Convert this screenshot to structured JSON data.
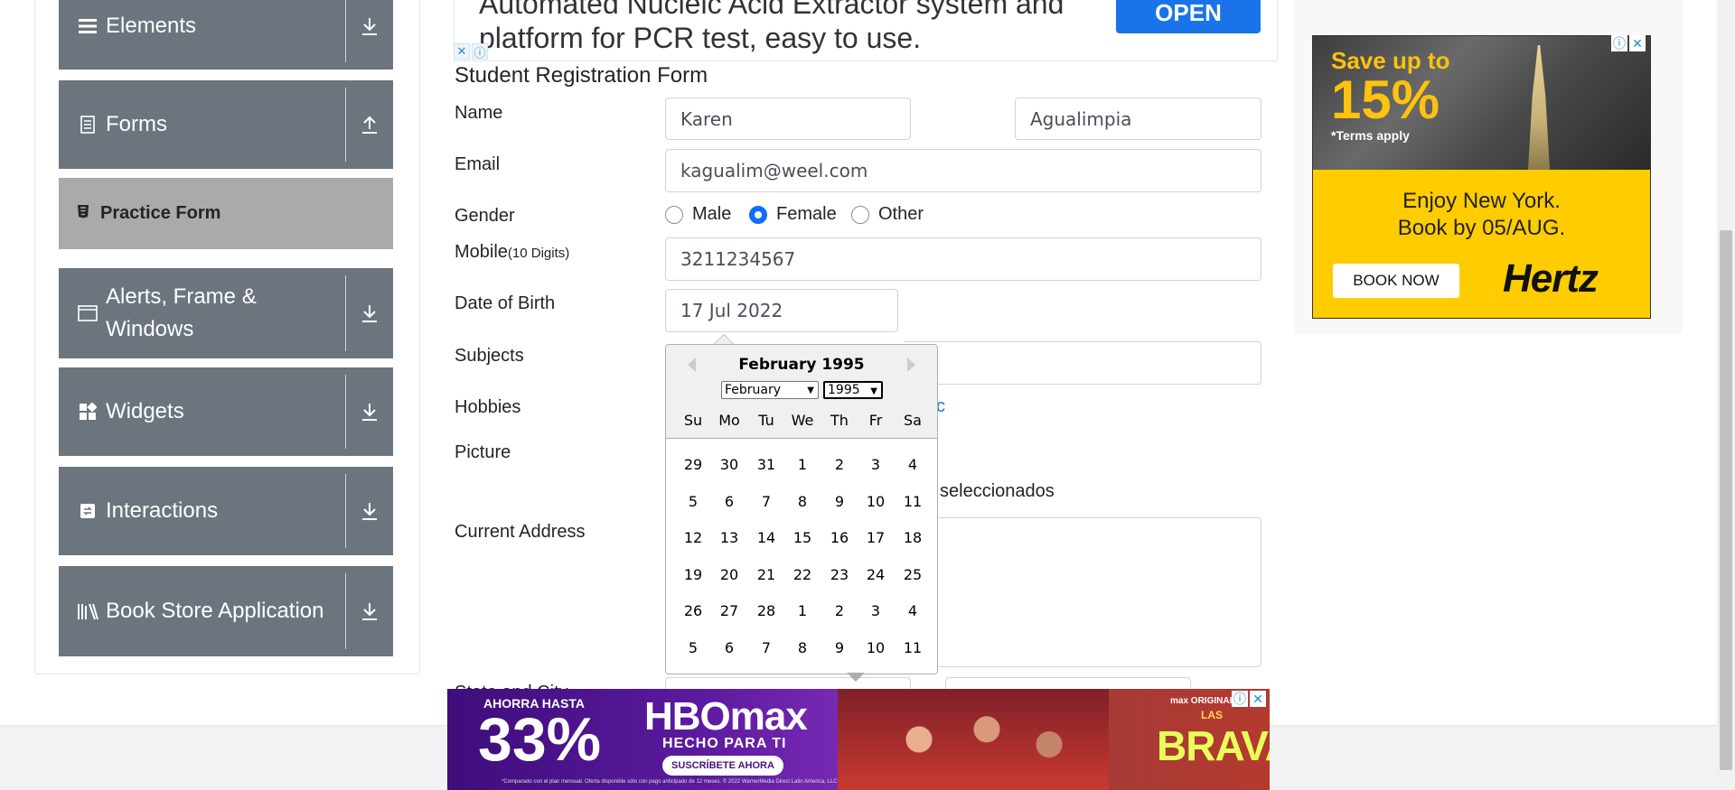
{
  "sidebar": {
    "groups": [
      {
        "label": "Elements",
        "icon": "list-icon",
        "expanded": false
      },
      {
        "label": "Forms",
        "icon": "document-icon",
        "expanded": true
      },
      {
        "label": "Alerts, Frame & Windows",
        "icon": "window-icon",
        "expanded": false
      },
      {
        "label": "Widgets",
        "icon": "widgets-icon",
        "expanded": false
      },
      {
        "label": "Interactions",
        "icon": "interactions-icon",
        "expanded": false
      },
      {
        "label": "Book Store Application",
        "icon": "books-icon",
        "expanded": false
      }
    ],
    "forms_sub_item": {
      "label": "Practice Form",
      "icon": "html5-icon"
    }
  },
  "top_ad": {
    "text_line1": "Automated Nucleic Acid Extractor system and",
    "text_line2": "platform for PCR test, easy to use.",
    "button": "OPEN"
  },
  "form": {
    "title": "Student Registration Form",
    "name_label": "Name",
    "first_name": "Karen",
    "last_name": "Agualimpia",
    "email_label": "Email",
    "email": "kagualim@weel.com",
    "gender_label": "Gender",
    "gender_options": [
      "Male",
      "Female",
      "Other"
    ],
    "gender_selected": "Female",
    "mobile_label": "Mobile",
    "mobile_hint": "(10 Digits)",
    "mobile": "3211234567",
    "dob_label": "Date of Birth",
    "dob": "17 Jul 2022",
    "subjects_label": "Subjects",
    "hobbies_label": "Hobbies",
    "hobbies_visible_fragment": "c",
    "picture_label": "Picture",
    "picture_status_fragment": "seleccionados",
    "address_label": "Current Address",
    "state_label_fragment": "State and City"
  },
  "datepicker": {
    "header": "February 1995",
    "month_select": "February",
    "year_select": "1995",
    "weekdays": [
      "Su",
      "Mo",
      "Tu",
      "We",
      "Th",
      "Fr",
      "Sa"
    ],
    "weeks": [
      [
        "29",
        "30",
        "31",
        "1",
        "2",
        "3",
        "4"
      ],
      [
        "5",
        "6",
        "7",
        "8",
        "9",
        "10",
        "11"
      ],
      [
        "12",
        "13",
        "14",
        "15",
        "16",
        "17",
        "18"
      ],
      [
        "19",
        "20",
        "21",
        "22",
        "23",
        "24",
        "25"
      ],
      [
        "26",
        "27",
        "28",
        "1",
        "2",
        "3",
        "4"
      ],
      [
        "5",
        "6",
        "7",
        "8",
        "9",
        "10",
        "11"
      ]
    ]
  },
  "right_ad": {
    "save": "Save up to",
    "percent": "15%",
    "terms": "*Terms apply",
    "enjoy_line1": "Enjoy New York.",
    "enjoy_line2": "Book by 05/AUG.",
    "button": "BOOK NOW",
    "brand": "Hertz"
  },
  "bottom_ad": {
    "line1": "AHORRA HASTA",
    "percent": "33%",
    "brand": "HBOmax",
    "tagline": "HECHO PARA TI",
    "cta": "SUSCRÍBETE AHORA",
    "original": "max ORIGINAL",
    "las": "LAS",
    "title": "BRAVAS",
    "fine_print": "*Comparado con el plan mensual. Oferta disponible sólo con pago anticipado de 12 meses. © 2022 WarnerMedia Direct Latin America, LLC. Todos los derechos reservados. HBO Max se usa bajo licencia."
  },
  "colors": {
    "sidebar_group": "#6c757d",
    "sidebar_active": "#aaaaaa",
    "radio_selected": "#0d6efd",
    "ad_button": "#1a73e8",
    "hertz_yellow": "#ffcc00"
  }
}
